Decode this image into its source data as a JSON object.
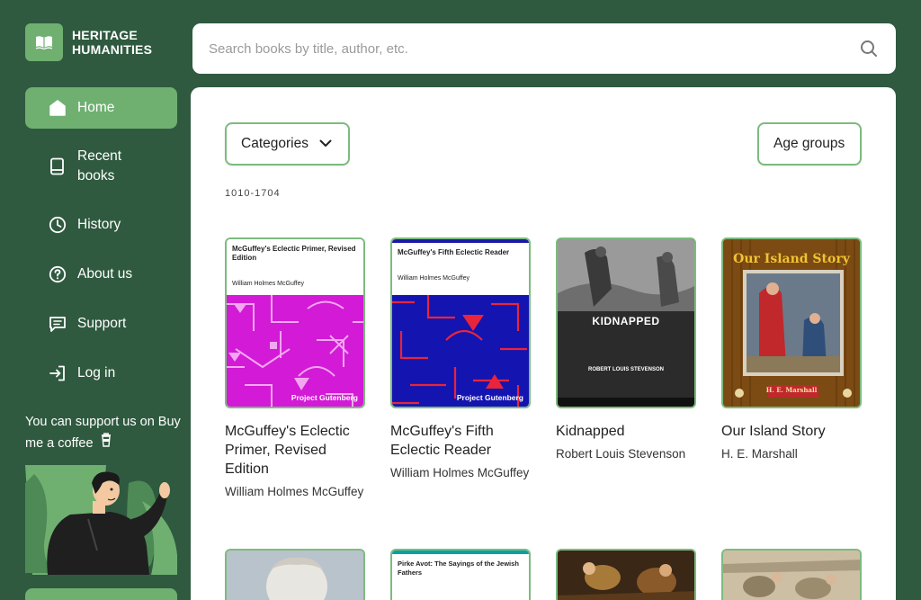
{
  "brand": {
    "line1": "HERITAGE",
    "line2": "HUMANITIES",
    "accent": "#6fb071",
    "bg": "#2f5a3f"
  },
  "search": {
    "placeholder": "Search books by title, author, etc."
  },
  "nav": [
    {
      "label": "Home",
      "icon": "home-icon"
    },
    {
      "label": "Recent books",
      "icon": "book-icon"
    },
    {
      "label": "History",
      "icon": "clock-icon"
    },
    {
      "label": "About us",
      "icon": "question-circle-icon"
    },
    {
      "label": "Support",
      "icon": "chat-icon"
    },
    {
      "label": "Log in",
      "icon": "login-icon"
    }
  ],
  "support": {
    "text": "You can support us on Buy me a coffee",
    "icon": "coffee-cup-icon"
  },
  "filters": {
    "categories_label": "Categories",
    "age_label": "Age groups"
  },
  "partial_text": "1010-1704",
  "books": [
    {
      "title": "McGuffey's Eclectic Primer, Revised Edition",
      "author": "William Holmes McGuffey",
      "cover": {
        "title": "McGuffey's Eclectic Primer, Revised Edition",
        "author": "William Holmes McGuffey",
        "publisher": "Project Gutenberg"
      }
    },
    {
      "title": "McGuffey's Fifth Eclectic Reader",
      "author": "William Holmes McGuffey",
      "cover": {
        "title": "McGuffey's Fifth Eclectic Reader",
        "author": "William Holmes McGuffey",
        "publisher": "Project Gutenberg"
      }
    },
    {
      "title": "Kidnapped",
      "author": "Robert Louis Stevenson",
      "cover": {
        "title": "KIDNAPPED",
        "author": "ROBERT LOUIS STEVENSON"
      }
    },
    {
      "title": "Our Island Story",
      "author": "H. E. Marshall",
      "cover": {
        "title": "Our Island Story",
        "author": "H. E. Marshall"
      }
    }
  ],
  "second_row": [
    {
      "cover_title": ""
    },
    {
      "cover_title": "Pirke Avot: The Sayings of the Jewish Fathers"
    },
    {
      "cover_title": ""
    },
    {
      "cover_title": ""
    }
  ]
}
